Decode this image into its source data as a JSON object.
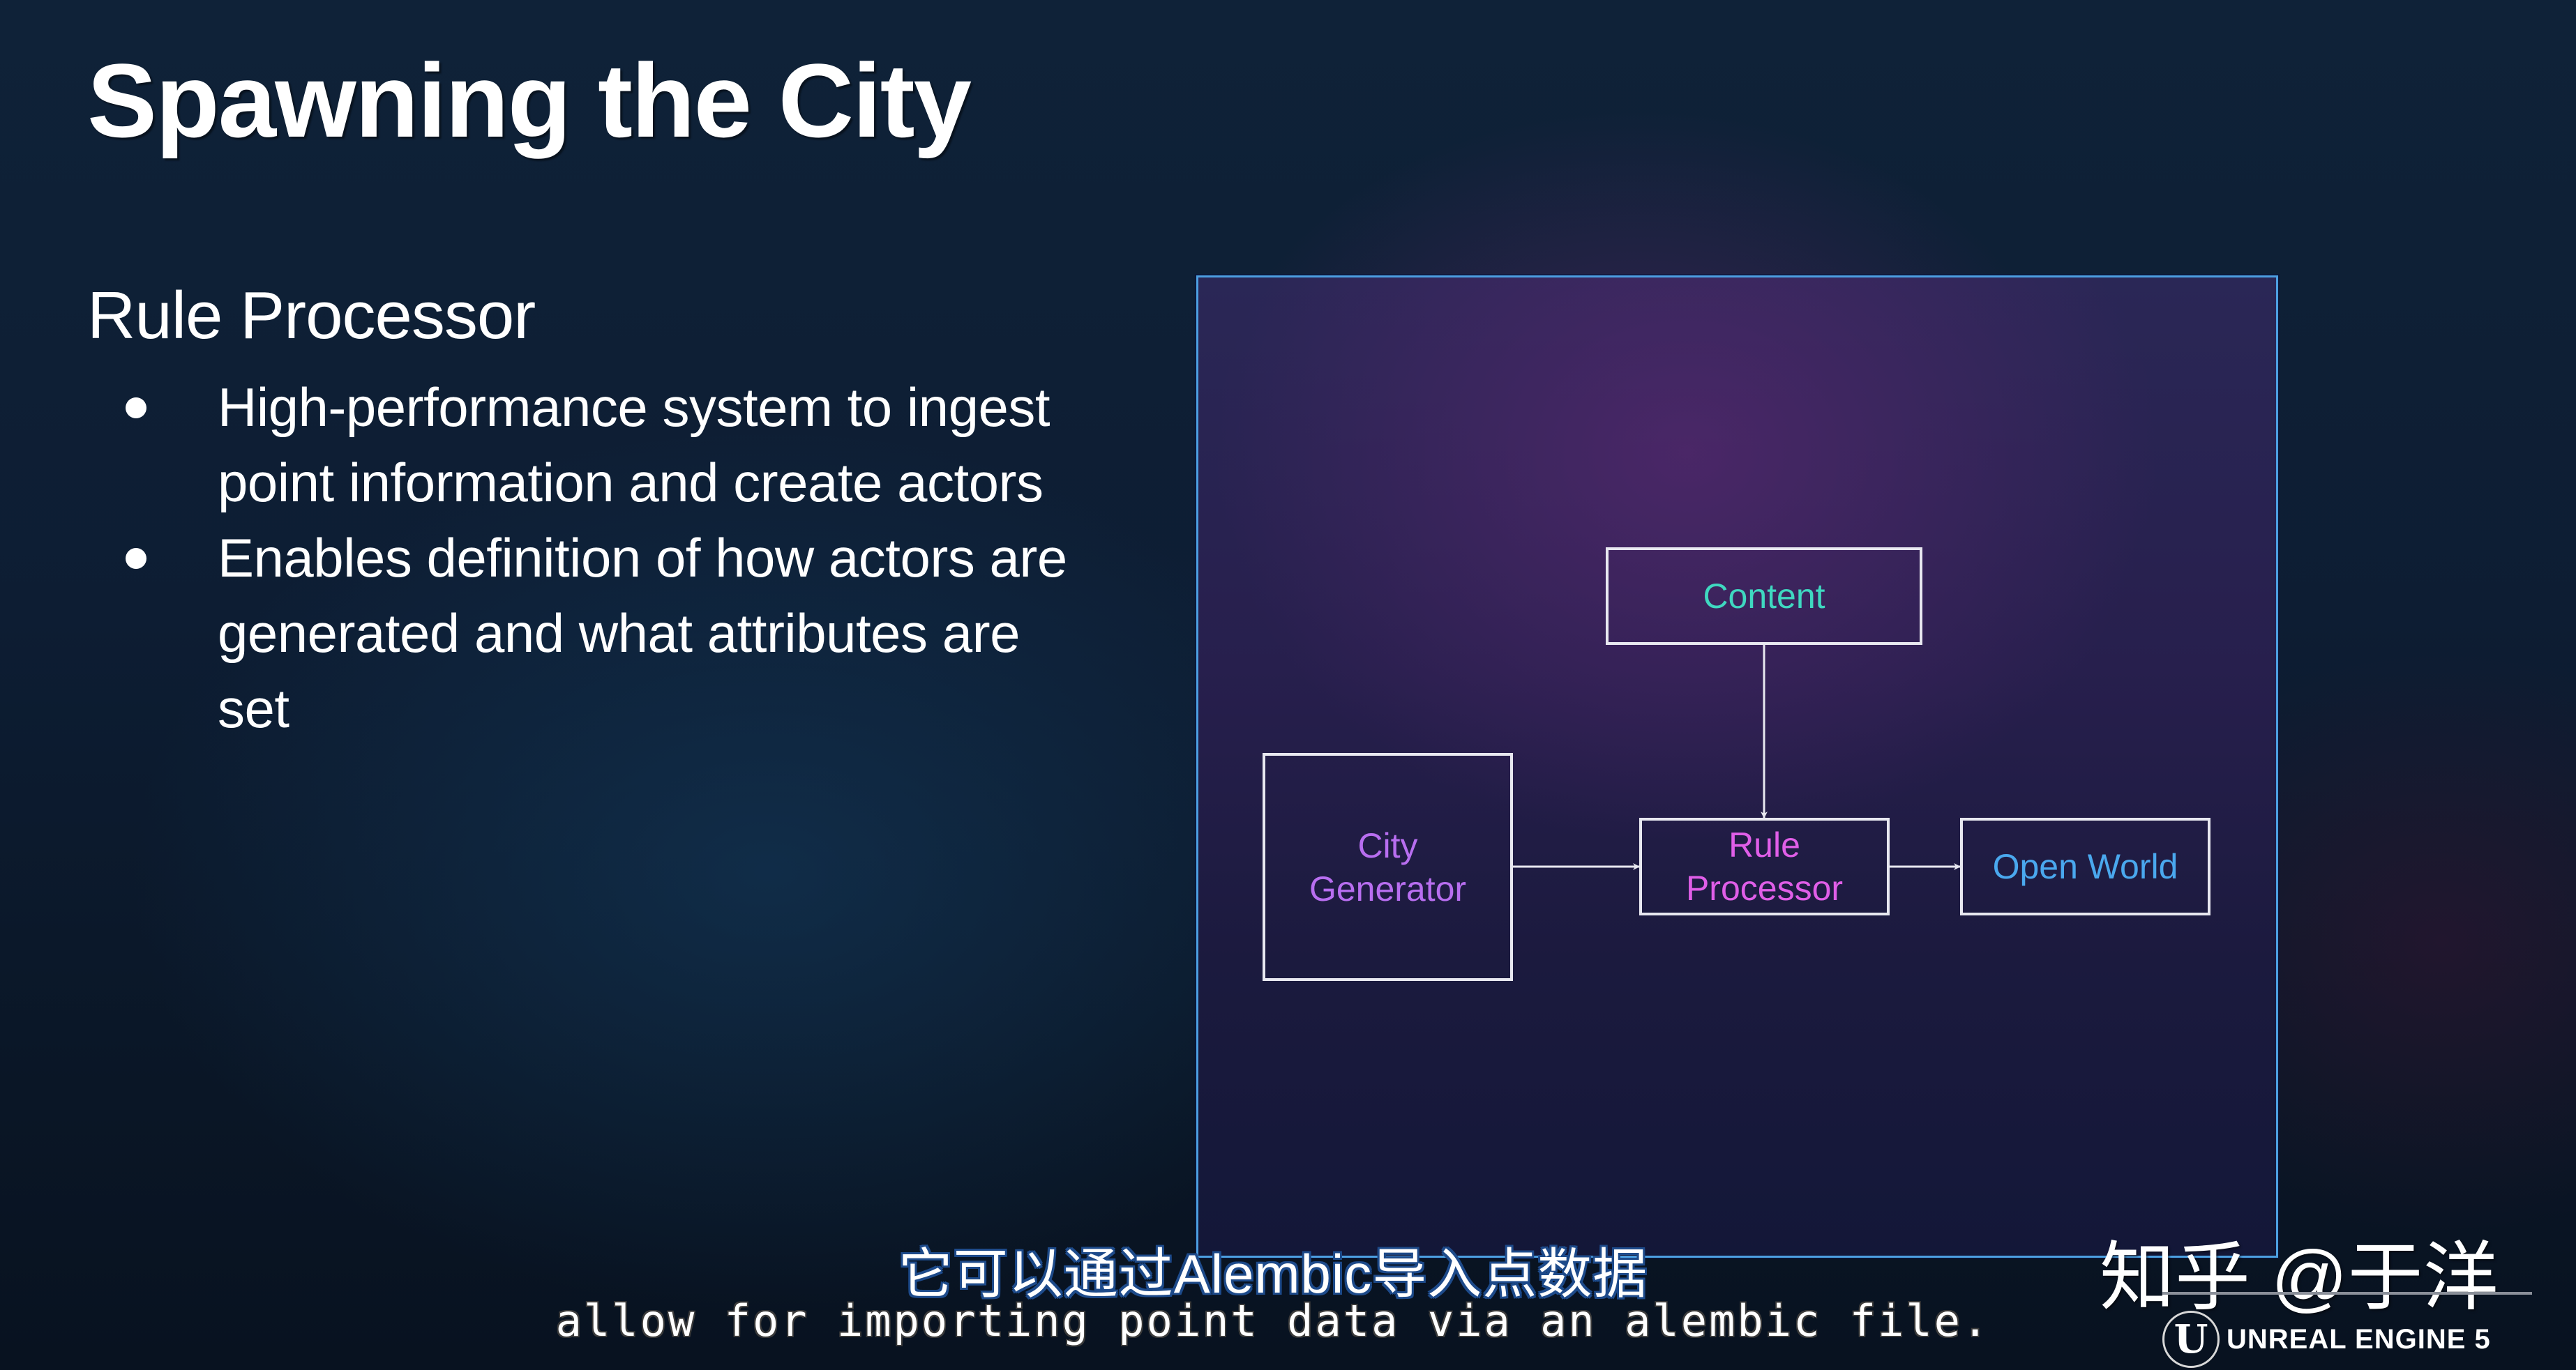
{
  "slide": {
    "title": "Spawning the City",
    "section_heading": "Rule Processor",
    "bullets": [
      "High-performance system to ingest point information and create actors",
      "Enables definition of how actors are generated and what attributes are set"
    ]
  },
  "diagram": {
    "frame_color": "#4c9fe2",
    "nodes": [
      {
        "id": "content",
        "label": "Content",
        "color": "#3fd8c0"
      },
      {
        "id": "city-generator",
        "label": "City\nGenerator",
        "color": "#b86ef0"
      },
      {
        "id": "rule-processor",
        "label": "Rule\nProcessor",
        "color": "#e05ee8"
      },
      {
        "id": "open-world",
        "label": "Open World",
        "color": "#4aa8ee"
      }
    ],
    "edges": [
      {
        "from": "content",
        "to": "rule-processor"
      },
      {
        "from": "city-generator",
        "to": "rule-processor"
      },
      {
        "from": "rule-processor",
        "to": "open-world"
      }
    ]
  },
  "subtitles": {
    "chinese": "它可以通过Alembic导入点数据",
    "english": "allow for importing point data via an alembic file."
  },
  "watermark": {
    "text": "知乎 @于洋"
  },
  "branding": {
    "logo_glyph": "U",
    "logo_text": "UNREAL ENGINE 5"
  }
}
